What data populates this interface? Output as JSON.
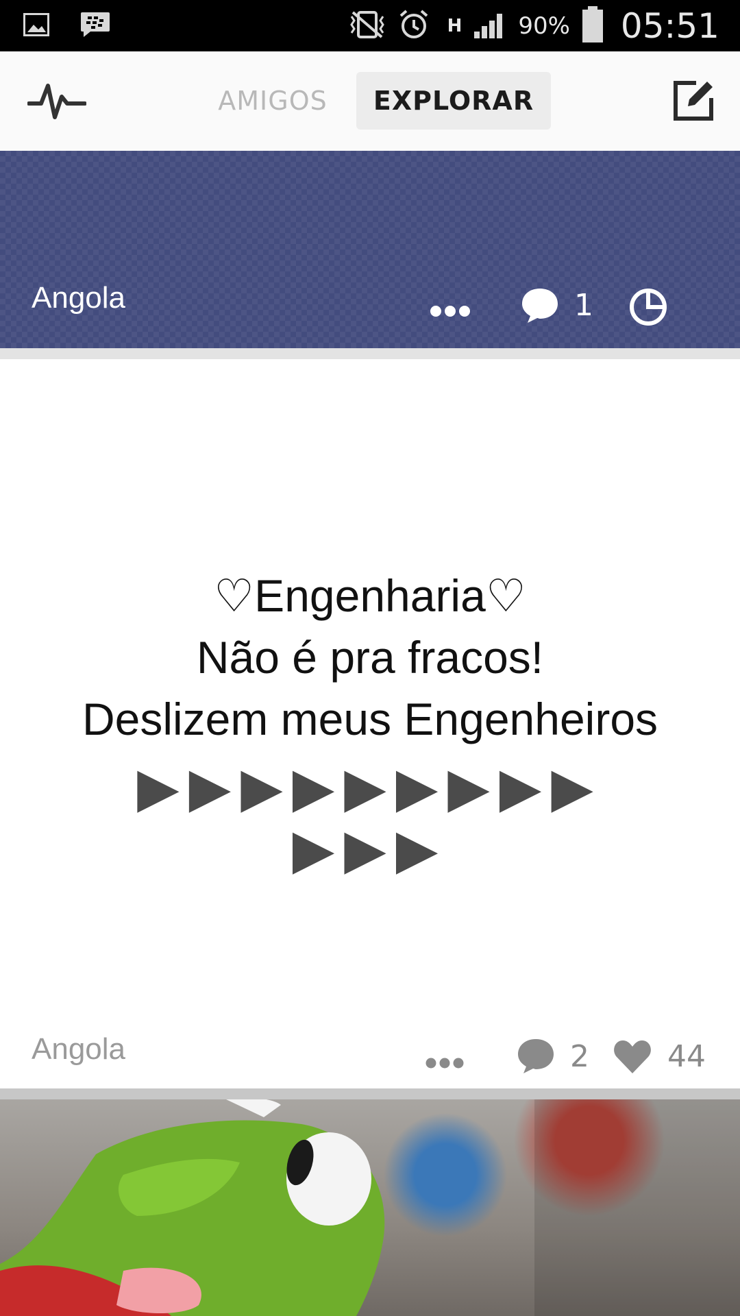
{
  "status_bar": {
    "battery": "90%",
    "time": "05:51",
    "network": "H",
    "icons": [
      "gallery-icon",
      "bbm-icon",
      "vibrate-icon",
      "alarm-icon",
      "signal-icon",
      "battery-icon"
    ]
  },
  "header": {
    "tabs": [
      {
        "label": "AMIGOS",
        "active": false
      },
      {
        "label": "EXPLORAR",
        "active": true
      }
    ],
    "left_icon": "pulse-icon",
    "right_icon": "compose-icon"
  },
  "banner": {
    "community": "Angola",
    "comment_count": "1",
    "color": "#434c7e"
  },
  "post": {
    "lines": [
      "♡Engenharia♡",
      "Não é pra fracos!",
      "Deslizem meus Engenheiros"
    ],
    "arrows_row1": "▶▶▶▶▶▶▶▶▶",
    "arrows_row2": "▶▶▶",
    "community": "Angola",
    "comment_count": "2",
    "like_count": "44"
  }
}
